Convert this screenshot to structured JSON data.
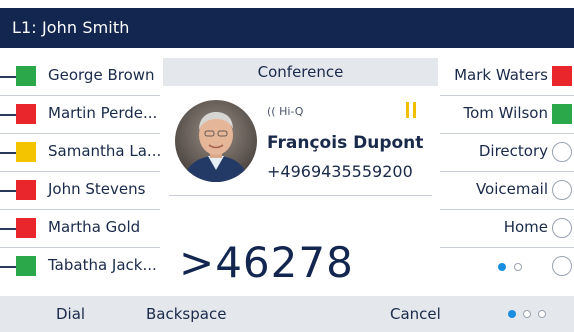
{
  "title_bar": {
    "label": "L1: John Smith"
  },
  "left_keys": [
    {
      "label": "George Brown",
      "status_color": "#2aa84a"
    },
    {
      "label": "Martin Perde...",
      "status_color": "#e8262b"
    },
    {
      "label": "Samantha La...",
      "status_color": "#f5c400"
    },
    {
      "label": "John Stevens",
      "status_color": "#e8262b"
    },
    {
      "label": "Martha Gold",
      "status_color": "#e8262b"
    },
    {
      "label": "Tabatha Jack...",
      "status_color": "#2aa84a"
    }
  ],
  "center": {
    "header": "Conference",
    "hd_badge": "Hi-Q",
    "caller_name": "François Dupont",
    "caller_number": "+4969435559200",
    "dialed_digits": ">46278",
    "avatar_icon": "contact-photo",
    "hold_icon": "pause-icon"
  },
  "right_keys": [
    {
      "label": "Mark Waters",
      "kind": "status",
      "status_color": "#e8262b"
    },
    {
      "label": "Tom Wilson",
      "kind": "status",
      "status_color": "#2aa84a"
    },
    {
      "label": "Directory",
      "kind": "circle"
    },
    {
      "label": "Voicemail",
      "kind": "circle"
    },
    {
      "label": "Home",
      "kind": "circle"
    },
    {
      "label": "",
      "kind": "page-indicator"
    }
  ],
  "right_page_indicator": {
    "current": 1,
    "total": 2
  },
  "softkeys": {
    "dial": "Dial",
    "backspace": "Backspace",
    "cancel": "Cancel",
    "page_current": 1,
    "page_total": 3
  },
  "colors": {
    "title_bar": "#12264f",
    "accent": "#1a8fe0",
    "softkey_bar": "#e4e7ec"
  }
}
